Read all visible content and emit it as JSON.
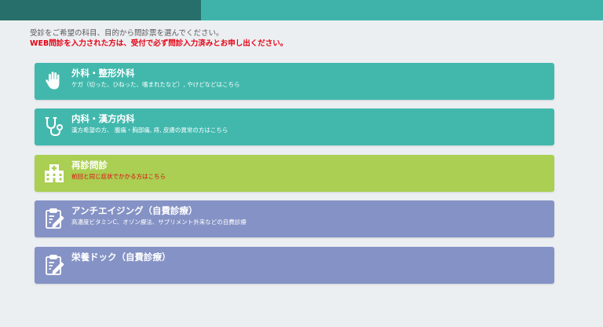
{
  "colors": {
    "header_teal": "#3fb3aa",
    "header_dark": "#276f6a",
    "card_teal": "#42b8ad",
    "card_green": "#aacf52",
    "card_purple": "#8592c5",
    "warning_red": "#e60012",
    "background": "#eceff2"
  },
  "intro": {
    "line1": "受診をご希望の科目、目的から問診票を選んでください。",
    "line2": "WEB問診を入力された方は、受付で必ず問診入力済みとお申し出ください。"
  },
  "cards": [
    {
      "icon": "hand-icon",
      "title": "外科・整形外科",
      "description": "ケガ（切った、ひねった、噛まれたなど）, やけどなどはこちら"
    },
    {
      "icon": "stethoscope-icon",
      "title": "内科・漢方内科",
      "description": "漢方希望の方、 腹痛・胸部痛, 痔, 皮膚の異常の方はこちら"
    },
    {
      "icon": "hospital-icon",
      "title": "再診問診",
      "description": "前回と同じ症状でかかる方はこちら"
    },
    {
      "icon": "clipboard-icon",
      "title": "アンチエイジング（自費診療）",
      "description": "高濃度ビタミンC、オゾン療法、サプリメント外来などの自費診療"
    },
    {
      "icon": "clipboard-icon",
      "title": "栄養ドック（自費診療）",
      "description": ""
    }
  ]
}
